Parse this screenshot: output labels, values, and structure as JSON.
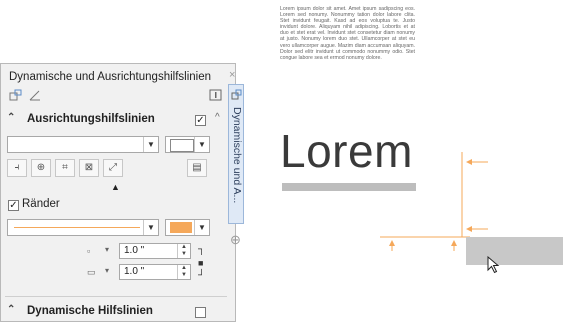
{
  "panel": {
    "title": "Dynamische und Ausrichtungshilfslinien",
    "close_glyph": "×",
    "sections": {
      "alignment": {
        "label": "Ausrichtungshilfslinien",
        "checked": true,
        "chevron": "⌃"
      },
      "margins": {
        "label": "Ränder",
        "checked": true
      },
      "dynamic": {
        "label": "Dynamische Hilfslinien",
        "checked": false,
        "chevron": "⌃"
      }
    },
    "margin_values": {
      "horizontal": "1.0 \"",
      "vertical": "1.0 \""
    },
    "line_color": "#f5a85a"
  },
  "side_tab": {
    "label": "Dynamische und A...",
    "plus_glyph": "⊕"
  },
  "preview": {
    "paragraph": "Lorem ipsum dolor sit amet. Amet ipsum sadipscing eos. Lorem sed nonumy. Nonummy tation dolor labore clita. Stet invidunt feugait. Kasd ad eos voluptua te. Justo invidunt dolore. Aliquyam nihil adipiscing. Lobortis et at duo et stet erat vel. Invidunt stet consetetur diam nonumy at justo. Nonumy lorem duo stet. Ullamcorper at stet eu vero ullamcorper augue. Mazim diam accumsan aliquyam. Dolor sed elitr invidunt ut commodo nonummy odio. Stet congue labore sea et ermod nonumy dolore.",
    "heading": "Lorem",
    "guide_color": "#f5a85a",
    "shape_color": "#c8c8c8"
  }
}
